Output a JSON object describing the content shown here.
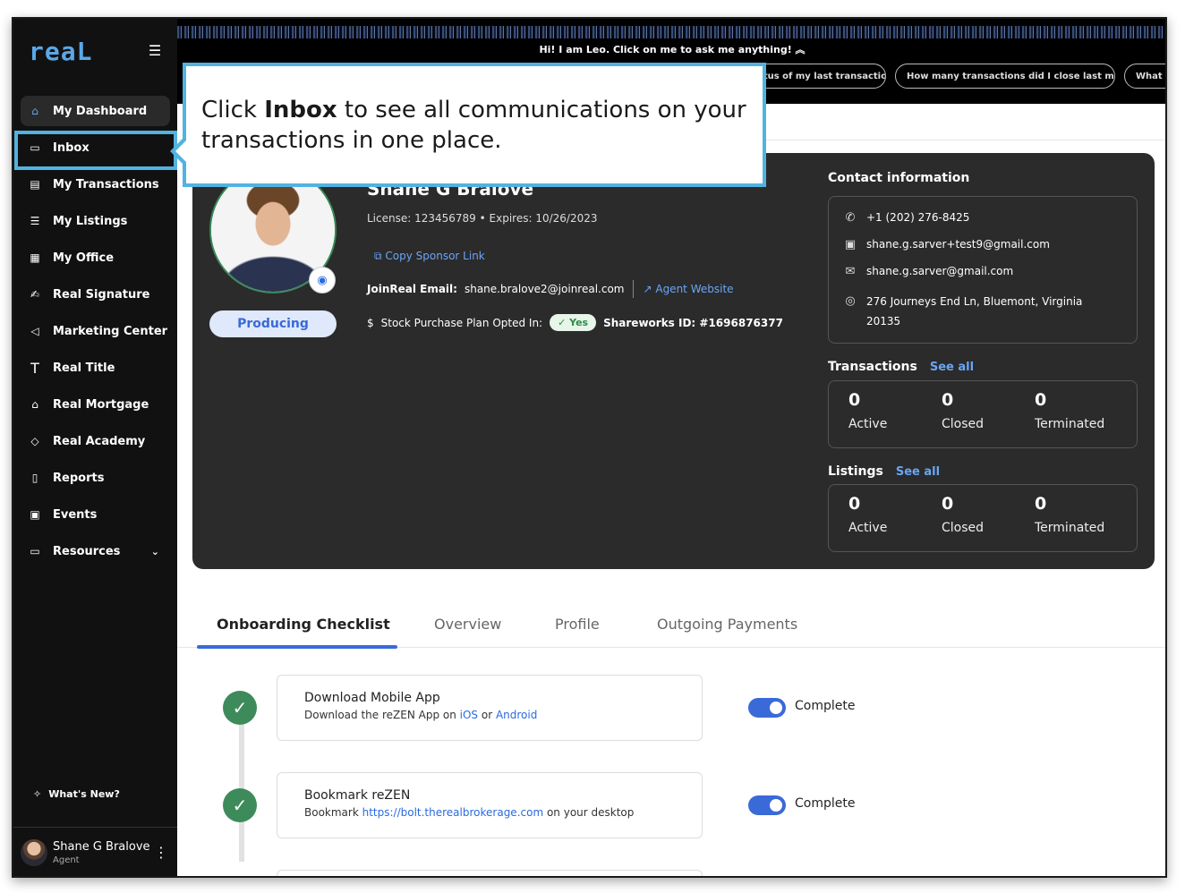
{
  "brand": {
    "logo": "reaL",
    "accent": "#6aa5f5",
    "highlight": "#52b2e0"
  },
  "leo": {
    "prompt": "Hi! I am Leo. Click on me to ask me anything! ︽",
    "chips": [
      "What's the status of my last transaction?",
      "How many transactions did I close last month?",
      "What w"
    ]
  },
  "sidebar": {
    "items": [
      {
        "label": "My Dashboard",
        "icon": "home-icon"
      },
      {
        "label": "Inbox",
        "icon": "inbox-icon"
      },
      {
        "label": "My Transactions",
        "icon": "clipboard-icon"
      },
      {
        "label": "My Listings",
        "icon": "list-icon"
      },
      {
        "label": "My Office",
        "icon": "building-icon"
      },
      {
        "label": "Real Signature",
        "icon": "signature-icon"
      },
      {
        "label": "Marketing Center",
        "icon": "megaphone-icon"
      },
      {
        "label": "Real Title",
        "icon": "title-icon"
      },
      {
        "label": "Real Mortgage",
        "icon": "bank-icon"
      },
      {
        "label": "Real Academy",
        "icon": "graduation-cap-icon"
      },
      {
        "label": "Reports",
        "icon": "report-icon"
      },
      {
        "label": "Events",
        "icon": "calendar-icon"
      },
      {
        "label": "Resources",
        "icon": "folder-icon"
      }
    ],
    "whats_new": "What's New?",
    "user": {
      "name": "Shane G Bralove",
      "role": "Agent"
    }
  },
  "profile": {
    "name": "Shane G Bralove",
    "license": "License: 123456789  •  Expires: 10/26/2023",
    "status_badge": "Producing",
    "copy_sponsor": "Copy Sponsor Link",
    "email_label": "JoinReal Email:",
    "email": "shane.bralove2@joinreal.com",
    "agent_website": "Agent Website",
    "stock_label": "Stock Purchase Plan Opted In:",
    "stock_value": "Yes",
    "shareworks": "Shareworks ID:  #1696876377"
  },
  "contact": {
    "title": "Contact information",
    "phone": "+1 (202) 276-8425",
    "alt_email": "shane.g.sarver+test9@gmail.com",
    "email": "shane.g.sarver@gmail.com",
    "address_line1": "276 Journeys End Ln, Bluemont, Virginia",
    "address_line2": "20135"
  },
  "transactions": {
    "title": "Transactions",
    "see_all": "See all",
    "stats": [
      {
        "num": "0",
        "label": "Active"
      },
      {
        "num": "0",
        "label": "Closed"
      },
      {
        "num": "0",
        "label": "Terminated"
      }
    ]
  },
  "listings": {
    "title": "Listings",
    "see_all": "See all",
    "stats": [
      {
        "num": "0",
        "label": "Active"
      },
      {
        "num": "0",
        "label": "Closed"
      },
      {
        "num": "0",
        "label": "Terminated"
      }
    ]
  },
  "tabs": [
    "Onboarding Checklist",
    "Overview",
    "Profile",
    "Outgoing Payments"
  ],
  "checklist": [
    {
      "title": "Download Mobile App",
      "desc_pre": "Download the reZEN App on ",
      "link1": "iOS",
      "mid": " or ",
      "link2": "Android",
      "status": "Complete"
    },
    {
      "title": "Bookmark reZEN",
      "desc_pre": "Bookmark ",
      "link1": "https://bolt.therealbrokerage.com",
      "mid": " on your desktop",
      "status": "Complete"
    }
  ],
  "tooltip": {
    "pre": "Click ",
    "bold": "Inbox",
    "post": " to see all communications on your transactions in one place."
  }
}
